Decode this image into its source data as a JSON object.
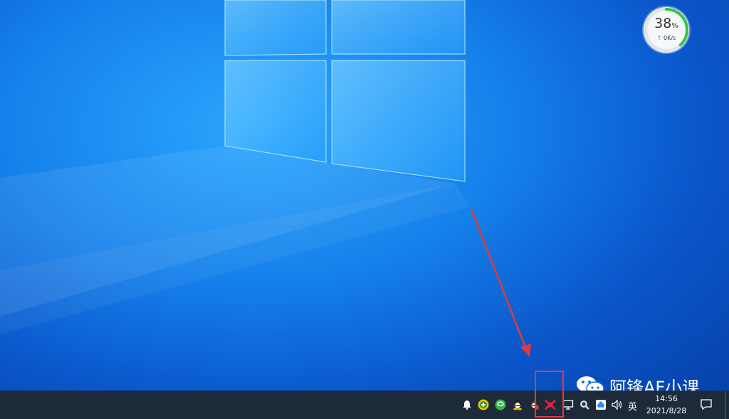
{
  "widget": {
    "percent": "38",
    "percent_unit": "%",
    "speed": "0K/s",
    "ring_fraction": 0.38,
    "ring_color": "#35c24a"
  },
  "watermark": {
    "text": "阿锋AF小课"
  },
  "tray": {
    "icons": [
      "bell-icon",
      "plus-circle-icon",
      "green-circle-icon",
      "qq-penguin-icon",
      "red-penguin-icon",
      "red-x-network-icon",
      "network-monitor-icon",
      "wrench-icon",
      "cloud-sync-icon",
      "volume-icon"
    ],
    "ime_label": "英",
    "time": "14:56",
    "date": "2021/8/28"
  },
  "colors": {
    "annotation_red": "#e13a3a",
    "taskbar_bg": "#1d2a3a"
  }
}
